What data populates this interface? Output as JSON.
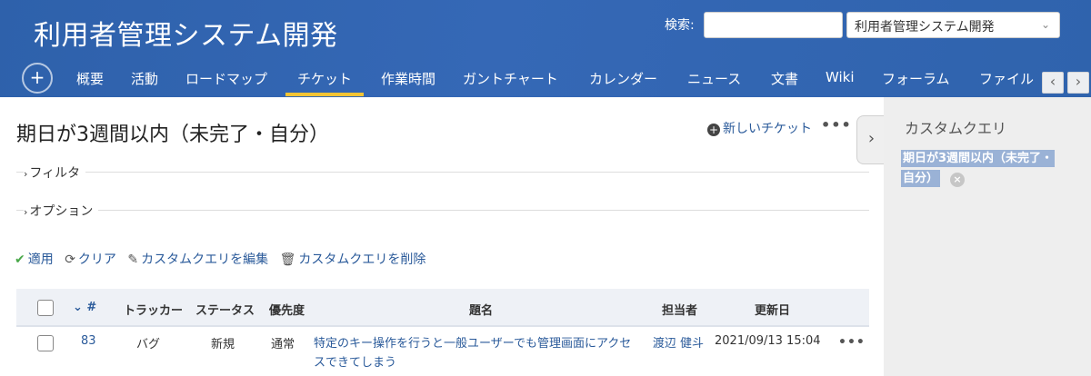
{
  "header": {
    "project_title": "利用者管理システム開発",
    "search_label": "検索:",
    "search_value": "",
    "project_select": "利用者管理システム開発"
  },
  "menu": {
    "add_label": "+",
    "tabs": [
      {
        "label": "概要"
      },
      {
        "label": "活動"
      },
      {
        "label": "ロードマップ"
      },
      {
        "label": "チケット",
        "active": true
      },
      {
        "label": "作業時間"
      },
      {
        "label": "ガントチャート"
      },
      {
        "label": "カレンダー"
      },
      {
        "label": "ニュース"
      },
      {
        "label": "文書"
      },
      {
        "label": "Wiki"
      },
      {
        "label": "フォーラム"
      },
      {
        "label": "ファイル"
      }
    ],
    "scroll_left": "‹",
    "scroll_right": "›"
  },
  "main": {
    "title": "期日が3週間以内（未完了・自分）",
    "new_issue": "新しいチケット",
    "filter_label": "フィルタ",
    "options_label": "オプション",
    "actions": {
      "apply": "適用",
      "clear": "クリア",
      "edit_query": "カスタムクエリを編集",
      "delete_query": "カスタムクエリを削除"
    }
  },
  "table": {
    "columns": {
      "id": "#",
      "tracker": "トラッカー",
      "status": "ステータス",
      "priority": "優先度",
      "subject": "題名",
      "assignee": "担当者",
      "updated": "更新日"
    },
    "rows": [
      {
        "id": "83",
        "tracker": "バグ",
        "status": "新規",
        "priority": "通常",
        "subject": "特定のキー操作を行うと一般ユーザーでも管理画面にアクセスできてしまう",
        "assignee": "渡辺 健斗",
        "updated": "2021/09/13 15:04"
      }
    ]
  },
  "sidebar": {
    "title": "カスタムクエリ",
    "query_chip": "期日が3週間以内（未完了・自分）"
  },
  "colors": {
    "header_bg": "#3166b2",
    "active_tab_underline": "#f3c434",
    "link": "#2a5a9a",
    "sidebar_bg": "#eeeeee"
  }
}
